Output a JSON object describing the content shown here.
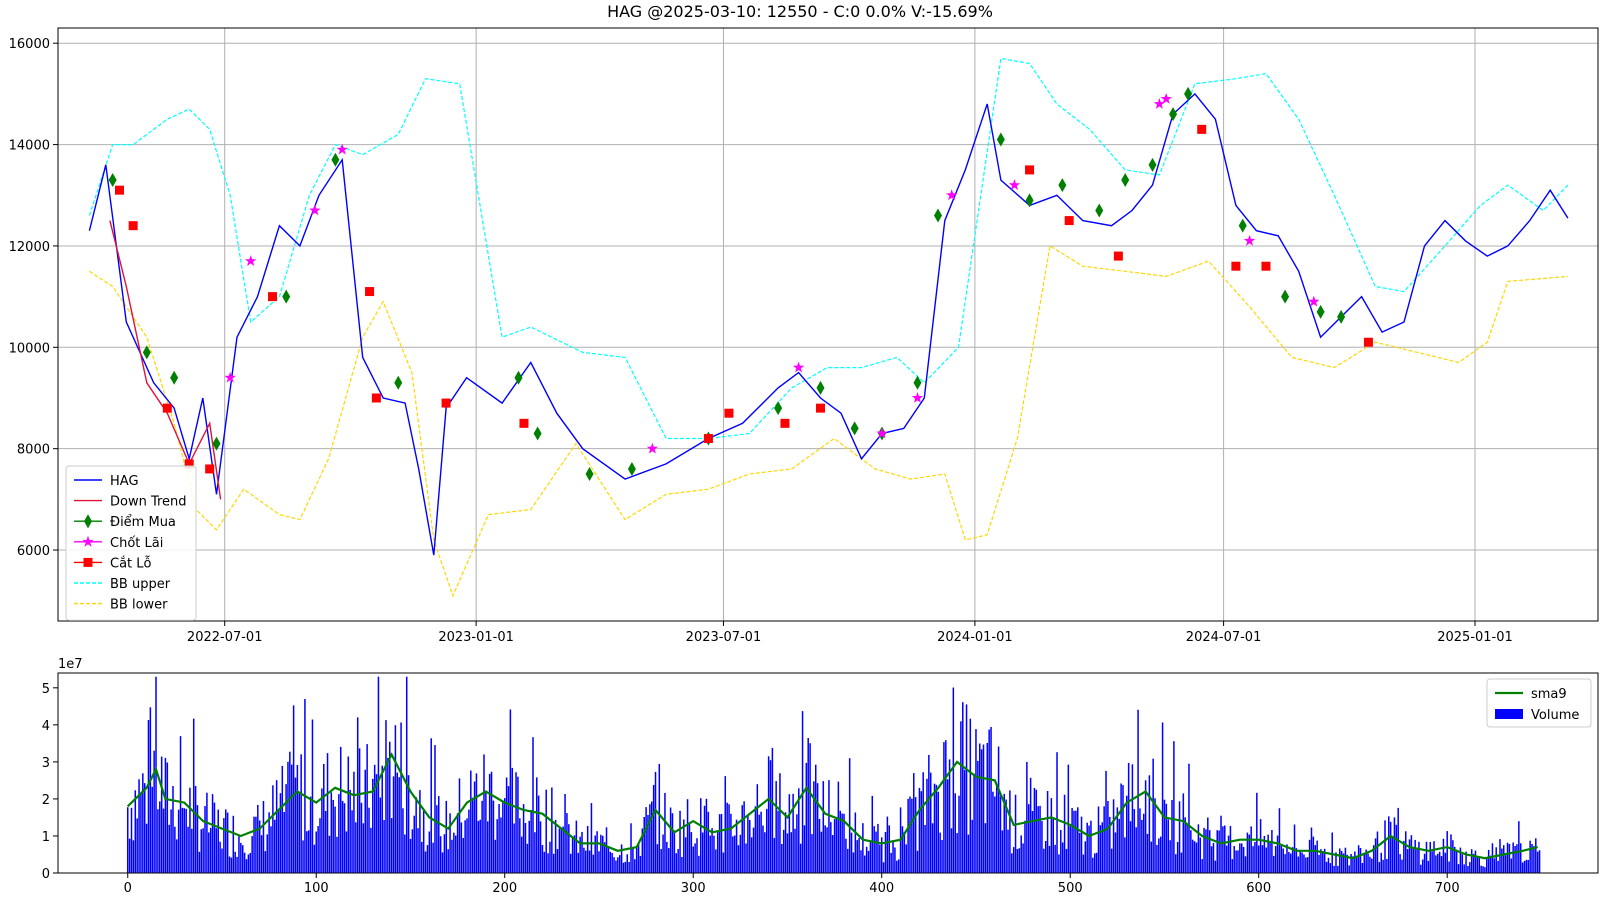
{
  "chart_data": [
    {
      "type": "line",
      "title": "HAG @2025-03-10: 12550 - C:0 0.0% V:-15.69%",
      "xlabel": "",
      "ylabel": "",
      "x_ticks": [
        "2022-07-01",
        "2023-01-01",
        "2023-07-01",
        "2024-01-01",
        "2024-07-01",
        "2025-01-01"
      ],
      "y_ticks": [
        6000,
        8000,
        10000,
        12000,
        14000,
        16000
      ],
      "xlim": [
        "2022-03-01",
        "2025-04-01"
      ],
      "ylim": [
        4600,
        16300
      ],
      "grid": true,
      "legend_position": "lower-left",
      "colors": {
        "HAG": "#0000ff",
        "Down Trend": "#dc143c",
        "Diem Mua": "#008000",
        "Chot Lai": "#ff00ff",
        "Cat Lo": "#ff0000",
        "BB upper": "#00ffff",
        "BB lower": "#ffd700"
      },
      "legend": [
        "HAG",
        "Down Trend",
        "Điểm Mua",
        "Chốt Lãi",
        "Cắt Lỗ",
        "BB upper",
        "BB lower"
      ],
      "series": [
        {
          "name": "HAG",
          "x": [
            "2022-03-24",
            "2022-04-05",
            "2022-04-20",
            "2022-05-10",
            "2022-05-25",
            "2022-06-05",
            "2022-06-15",
            "2022-06-25",
            "2022-07-10",
            "2022-07-25",
            "2022-08-10",
            "2022-08-25",
            "2022-09-08",
            "2022-09-25",
            "2022-10-10",
            "2022-10-25",
            "2022-11-10",
            "2022-11-20",
            "2022-12-01",
            "2022-12-10",
            "2022-12-25",
            "2023-01-20",
            "2023-02-10",
            "2023-03-01",
            "2023-03-20",
            "2023-04-20",
            "2023-05-20",
            "2023-06-20",
            "2023-07-15",
            "2023-08-10",
            "2023-08-25",
            "2023-09-10",
            "2023-09-25",
            "2023-10-10",
            "2023-10-25",
            "2023-11-10",
            "2023-11-25",
            "2023-12-10",
            "2023-12-25",
            "2024-01-10",
            "2024-01-20",
            "2024-02-10",
            "2024-03-01",
            "2024-03-20",
            "2024-04-10",
            "2024-04-25",
            "2024-05-10",
            "2024-05-25",
            "2024-06-10",
            "2024-06-25",
            "2024-07-10",
            "2024-07-25",
            "2024-08-10",
            "2024-08-25",
            "2024-09-10",
            "2024-09-25",
            "2024-10-10",
            "2024-10-25",
            "2024-11-10",
            "2024-11-25",
            "2024-12-10",
            "2024-12-25",
            "2025-01-10",
            "2025-01-25",
            "2025-02-10",
            "2025-02-25",
            "2025-03-10"
          ],
          "values": [
            12300,
            13600,
            10500,
            9300,
            8800,
            7800,
            9000,
            7100,
            10200,
            11000,
            12400,
            12000,
            13000,
            13700,
            9800,
            9000,
            8900,
            7600,
            5900,
            8800,
            9400,
            8900,
            9700,
            8700,
            8000,
            7400,
            7700,
            8200,
            8500,
            9200,
            9500,
            9000,
            8700,
            7800,
            8300,
            8400,
            9000,
            12500,
            13500,
            14800,
            13300,
            12800,
            13000,
            12500,
            12400,
            12700,
            13200,
            14600,
            15000,
            14500,
            12800,
            12300,
            12200,
            11500,
            10200,
            10600,
            11000,
            10300,
            10500,
            12000,
            12500,
            12100,
            11800,
            12000,
            12500,
            13100,
            12550
          ]
        },
        {
          "name": "Down Trend",
          "x": [
            "2022-04-08",
            "2022-04-20",
            "2022-05-05",
            "2022-05-20",
            "2022-06-05",
            "2022-06-20",
            "2022-06-28"
          ],
          "values": [
            12500,
            11200,
            9300,
            8700,
            7700,
            8500,
            7000
          ]
        },
        {
          "name": "BB upper",
          "x": [
            "2022-03-24",
            "2022-04-10",
            "2022-04-25",
            "2022-05-20",
            "2022-06-05",
            "2022-06-20",
            "2022-07-05",
            "2022-07-20",
            "2022-08-10",
            "2022-09-01",
            "2022-09-20",
            "2022-10-10",
            "2022-11-05",
            "2022-11-25",
            "2022-12-20",
            "2023-01-20",
            "2023-02-10",
            "2023-03-20",
            "2023-04-20",
            "2023-05-20",
            "2023-06-20",
            "2023-07-20",
            "2023-08-20",
            "2023-09-15",
            "2023-10-10",
            "2023-11-05",
            "2023-11-25",
            "2023-12-20",
            "2024-01-20",
            "2024-02-10",
            "2024-03-01",
            "2024-03-25",
            "2024-04-20",
            "2024-05-15",
            "2024-06-10",
            "2024-07-10",
            "2024-08-01",
            "2024-08-25",
            "2024-09-20",
            "2024-10-20",
            "2024-11-10",
            "2024-12-10",
            "2025-01-05",
            "2025-01-25",
            "2025-02-20",
            "2025-03-10"
          ],
          "values": [
            12600,
            14000,
            14000,
            14500,
            14700,
            14300,
            13000,
            10500,
            11000,
            13000,
            14000,
            13800,
            14200,
            15300,
            15200,
            10200,
            10400,
            9900,
            9800,
            8200,
            8200,
            8300,
            9200,
            9600,
            9600,
            9800,
            9300,
            10000,
            15700,
            15600,
            14800,
            14300,
            13500,
            13400,
            15200,
            15300,
            15400,
            14500,
            13000,
            11200,
            11100,
            12000,
            12800,
            13200,
            12700,
            13200
          ]
        },
        {
          "name": "BB lower",
          "x": [
            "2022-03-24",
            "2022-04-10",
            "2022-05-05",
            "2022-05-25",
            "2022-06-10",
            "2022-06-25",
            "2022-07-15",
            "2022-08-10",
            "2022-08-25",
            "2022-09-15",
            "2022-10-10",
            "2022-10-25",
            "2022-11-15",
            "2022-12-01",
            "2022-12-15",
            "2023-01-10",
            "2023-02-10",
            "2023-03-15",
            "2023-04-20",
            "2023-05-20",
            "2023-06-20",
            "2023-07-20",
            "2023-08-20",
            "2023-09-20",
            "2023-10-20",
            "2023-11-15",
            "2023-12-10",
            "2023-12-25",
            "2024-01-10",
            "2024-02-01",
            "2024-02-25",
            "2024-03-20",
            "2024-04-20",
            "2024-05-20",
            "2024-06-20",
            "2024-07-20",
            "2024-08-20",
            "2024-09-20",
            "2024-10-20",
            "2024-11-20",
            "2024-12-20",
            "2025-01-10",
            "2025-01-25",
            "2025-03-10"
          ],
          "values": [
            11500,
            11200,
            10200,
            8500,
            6800,
            6400,
            7200,
            6700,
            6600,
            7800,
            10200,
            10900,
            9500,
            6200,
            5100,
            6700,
            6800,
            8100,
            6600,
            7100,
            7200,
            7500,
            7600,
            8200,
            7600,
            7400,
            7500,
            6200,
            6300,
            8200,
            12000,
            11600,
            11500,
            11400,
            11700,
            10800,
            9800,
            9600,
            10100,
            9900,
            9700,
            10100,
            11300,
            11400
          ]
        },
        {
          "name": "Điểm Mua",
          "type": "marker",
          "x": [
            "2022-04-10",
            "2022-05-05",
            "2022-05-25",
            "2022-06-25",
            "2022-08-15",
            "2022-09-20",
            "2022-11-05",
            "2023-02-01",
            "2023-02-15",
            "2023-03-25",
            "2023-04-25",
            "2023-06-20",
            "2023-08-10",
            "2023-09-10",
            "2023-10-05",
            "2023-10-25",
            "2023-11-20",
            "2023-12-05",
            "2024-01-20",
            "2024-02-10",
            "2024-03-05",
            "2024-04-01",
            "2024-04-20",
            "2024-05-10",
            "2024-05-25",
            "2024-06-05",
            "2024-07-15",
            "2024-08-15",
            "2024-09-10",
            "2024-09-25"
          ],
          "values": [
            13300,
            9900,
            9400,
            8100,
            11000,
            13700,
            9300,
            9400,
            8300,
            7500,
            7600,
            8200,
            8800,
            9200,
            8400,
            8300,
            9300,
            12600,
            14100,
            12900,
            13200,
            12700,
            13300,
            13600,
            14600,
            15000,
            12400,
            11000,
            10700,
            10600
          ]
        },
        {
          "name": "Chốt Lãi",
          "type": "marker",
          "x": [
            "2022-07-05",
            "2022-07-20",
            "2022-09-05",
            "2022-09-25",
            "2023-05-10",
            "2023-08-25",
            "2023-10-25",
            "2023-11-20",
            "2023-12-15",
            "2024-01-30",
            "2024-05-15",
            "2024-05-20",
            "2024-07-20",
            "2024-09-05"
          ],
          "values": [
            9400,
            11700,
            12700,
            13900,
            8000,
            9600,
            8300,
            9000,
            13000,
            13200,
            14800,
            14900,
            12100,
            10900
          ]
        },
        {
          "name": "Cắt Lỗ",
          "type": "marker",
          "x": [
            "2022-04-15",
            "2022-04-25",
            "2022-05-20",
            "2022-06-05",
            "2022-06-20",
            "2022-08-05",
            "2022-10-15",
            "2022-10-20",
            "2022-12-10",
            "2023-02-05",
            "2023-06-20",
            "2023-07-05",
            "2023-08-15",
            "2023-09-10",
            "2024-02-10",
            "2024-03-10",
            "2024-04-15",
            "2024-06-15",
            "2024-07-10",
            "2024-08-01",
            "2024-10-15"
          ],
          "values": [
            13100,
            12400,
            8800,
            7700,
            7600,
            11000,
            11100,
            9000,
            8900,
            8500,
            8200,
            8700,
            8500,
            8800,
            13500,
            12500,
            11800,
            14300,
            11600,
            11600,
            10100
          ]
        }
      ]
    },
    {
      "type": "bar",
      "title": "",
      "xlabel": "",
      "ylabel": "",
      "y_scale_label": "1e7",
      "x_ticks": [
        0,
        100,
        200,
        300,
        400,
        500,
        600,
        700
      ],
      "y_ticks": [
        0,
        1,
        2,
        3,
        4,
        5
      ],
      "xlim": [
        -37,
        780
      ],
      "ylim": [
        0,
        5.4
      ],
      "grid": false,
      "legend_position": "top-right",
      "colors": {
        "sma9": "#008000",
        "Volume": "#0000ff"
      },
      "legend": [
        "sma9",
        "Volume"
      ],
      "series": [
        {
          "name": "sma9",
          "x": [
            0,
            10,
            15,
            20,
            30,
            40,
            50,
            60,
            70,
            80,
            90,
            100,
            110,
            120,
            130,
            140,
            150,
            160,
            170,
            180,
            190,
            200,
            210,
            220,
            230,
            240,
            250,
            260,
            270,
            280,
            290,
            300,
            310,
            320,
            330,
            340,
            350,
            360,
            370,
            380,
            390,
            400,
            410,
            420,
            430,
            440,
            450,
            460,
            470,
            480,
            490,
            500,
            510,
            520,
            530,
            540,
            550,
            560,
            570,
            580,
            590,
            600,
            610,
            620,
            630,
            640,
            650,
            660,
            670,
            680,
            690,
            700,
            710,
            720,
            730,
            740,
            748
          ],
          "values": [
            1.8,
            2.3,
            2.8,
            2.0,
            1.9,
            1.4,
            1.2,
            1.0,
            1.2,
            1.7,
            2.2,
            1.9,
            2.3,
            2.1,
            2.2,
            3.2,
            2.2,
            1.5,
            1.2,
            1.9,
            2.2,
            1.9,
            1.7,
            1.6,
            1.2,
            0.8,
            0.8,
            0.6,
            0.7,
            1.7,
            1.1,
            1.4,
            1.1,
            1.2,
            1.6,
            2.0,
            1.5,
            2.3,
            1.6,
            1.4,
            0.9,
            0.8,
            0.9,
            1.7,
            2.3,
            3.0,
            2.6,
            2.5,
            1.3,
            1.4,
            1.5,
            1.3,
            1.0,
            1.2,
            1.9,
            2.2,
            1.5,
            1.4,
            1.0,
            0.8,
            0.9,
            0.9,
            0.8,
            0.6,
            0.6,
            0.5,
            0.4,
            0.6,
            1.0,
            0.7,
            0.6,
            0.7,
            0.5,
            0.4,
            0.5,
            0.6,
            0.7
          ]
        },
        {
          "name": "Volume",
          "x_count": 750,
          "profile_x": [
            0,
            10,
            15,
            20,
            30,
            40,
            50,
            60,
            70,
            80,
            90,
            100,
            110,
            120,
            130,
            140,
            150,
            160,
            170,
            180,
            190,
            200,
            210,
            220,
            230,
            240,
            250,
            260,
            270,
            280,
            290,
            300,
            310,
            320,
            330,
            340,
            350,
            360,
            370,
            380,
            390,
            400,
            410,
            420,
            430,
            440,
            450,
            460,
            470,
            480,
            490,
            500,
            510,
            520,
            530,
            540,
            550,
            560,
            570,
            580,
            590,
            600,
            610,
            620,
            630,
            640,
            650,
            660,
            670,
            680,
            690,
            700,
            710,
            720,
            730,
            740,
            749
          ],
          "profile_values": [
            1.8,
            2.3,
            2.8,
            2.0,
            1.9,
            1.4,
            1.2,
            1.0,
            1.2,
            1.7,
            2.2,
            1.9,
            2.3,
            2.1,
            2.2,
            3.2,
            2.2,
            1.5,
            1.2,
            1.9,
            2.2,
            1.9,
            1.7,
            1.6,
            1.2,
            0.8,
            0.8,
            0.6,
            0.7,
            1.7,
            1.1,
            1.4,
            1.1,
            1.2,
            1.6,
            2.0,
            1.5,
            2.3,
            1.6,
            1.4,
            0.9,
            0.8,
            0.9,
            1.7,
            2.3,
            3.0,
            2.6,
            2.5,
            1.3,
            1.4,
            1.5,
            1.3,
            1.0,
            1.2,
            1.9,
            2.2,
            1.5,
            1.4,
            1.0,
            0.8,
            0.9,
            0.9,
            0.8,
            0.6,
            0.6,
            0.5,
            0.4,
            0.6,
            1.0,
            0.7,
            0.6,
            0.7,
            0.5,
            0.4,
            0.5,
            0.6,
            0.4
          ]
        }
      ]
    }
  ]
}
